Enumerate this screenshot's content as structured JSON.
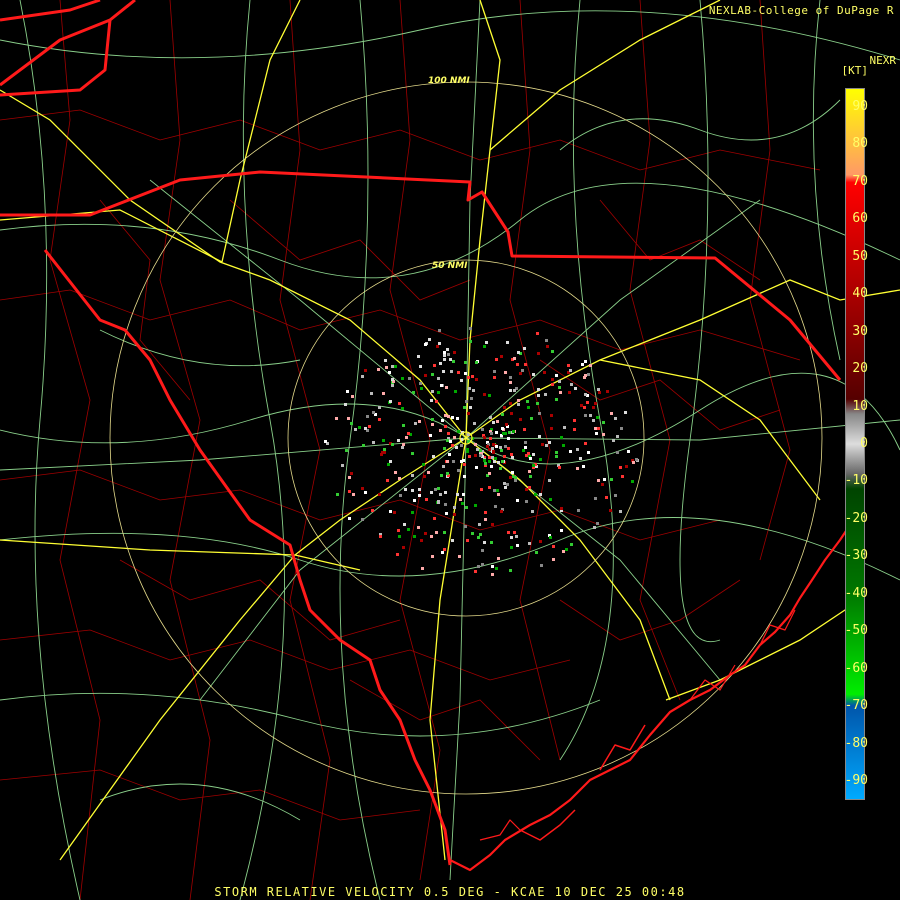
{
  "header": {
    "credit": "NEXLAB-College of DuPage R",
    "product": "NEXR",
    "unit": "[KT]"
  },
  "rings": {
    "inner_label": "50 NMI",
    "outer_label": "100 NMI"
  },
  "colorbar": {
    "ticks": [
      "90",
      "80",
      "70",
      "60",
      "50",
      "40",
      "30",
      "20",
      "10",
      "0",
      "-10",
      "-20",
      "-30",
      "-40",
      "-50",
      "-60",
      "-70",
      "-80",
      "-90"
    ],
    "stops": [
      {
        "v": 95,
        "c": "#ffff00"
      },
      {
        "v": 72,
        "c": "#ff9966"
      },
      {
        "v": 70,
        "c": "#ff0000"
      },
      {
        "v": 40,
        "c": "#aa0000"
      },
      {
        "v": 12,
        "c": "#550000"
      },
      {
        "v": 8,
        "c": "#888888"
      },
      {
        "v": 0,
        "c": "#dddddd"
      },
      {
        "v": -8,
        "c": "#666666"
      },
      {
        "v": -12,
        "c": "#004400"
      },
      {
        "v": -40,
        "c": "#007700"
      },
      {
        "v": -67,
        "c": "#00ee00"
      },
      {
        "v": -70,
        "c": "#0055aa"
      },
      {
        "v": -95,
        "c": "#00aaff"
      }
    ]
  },
  "colors": {
    "state_border": "#ff1a1a",
    "county_line": "#a00000",
    "highway": "#ffff33",
    "road": "#99e699",
    "range_ring": "#e6dc8c"
  },
  "footer": "STORM RELATIVE VELOCITY 0.5 DEG - KCAE 10 DEC 25 00:48"
}
